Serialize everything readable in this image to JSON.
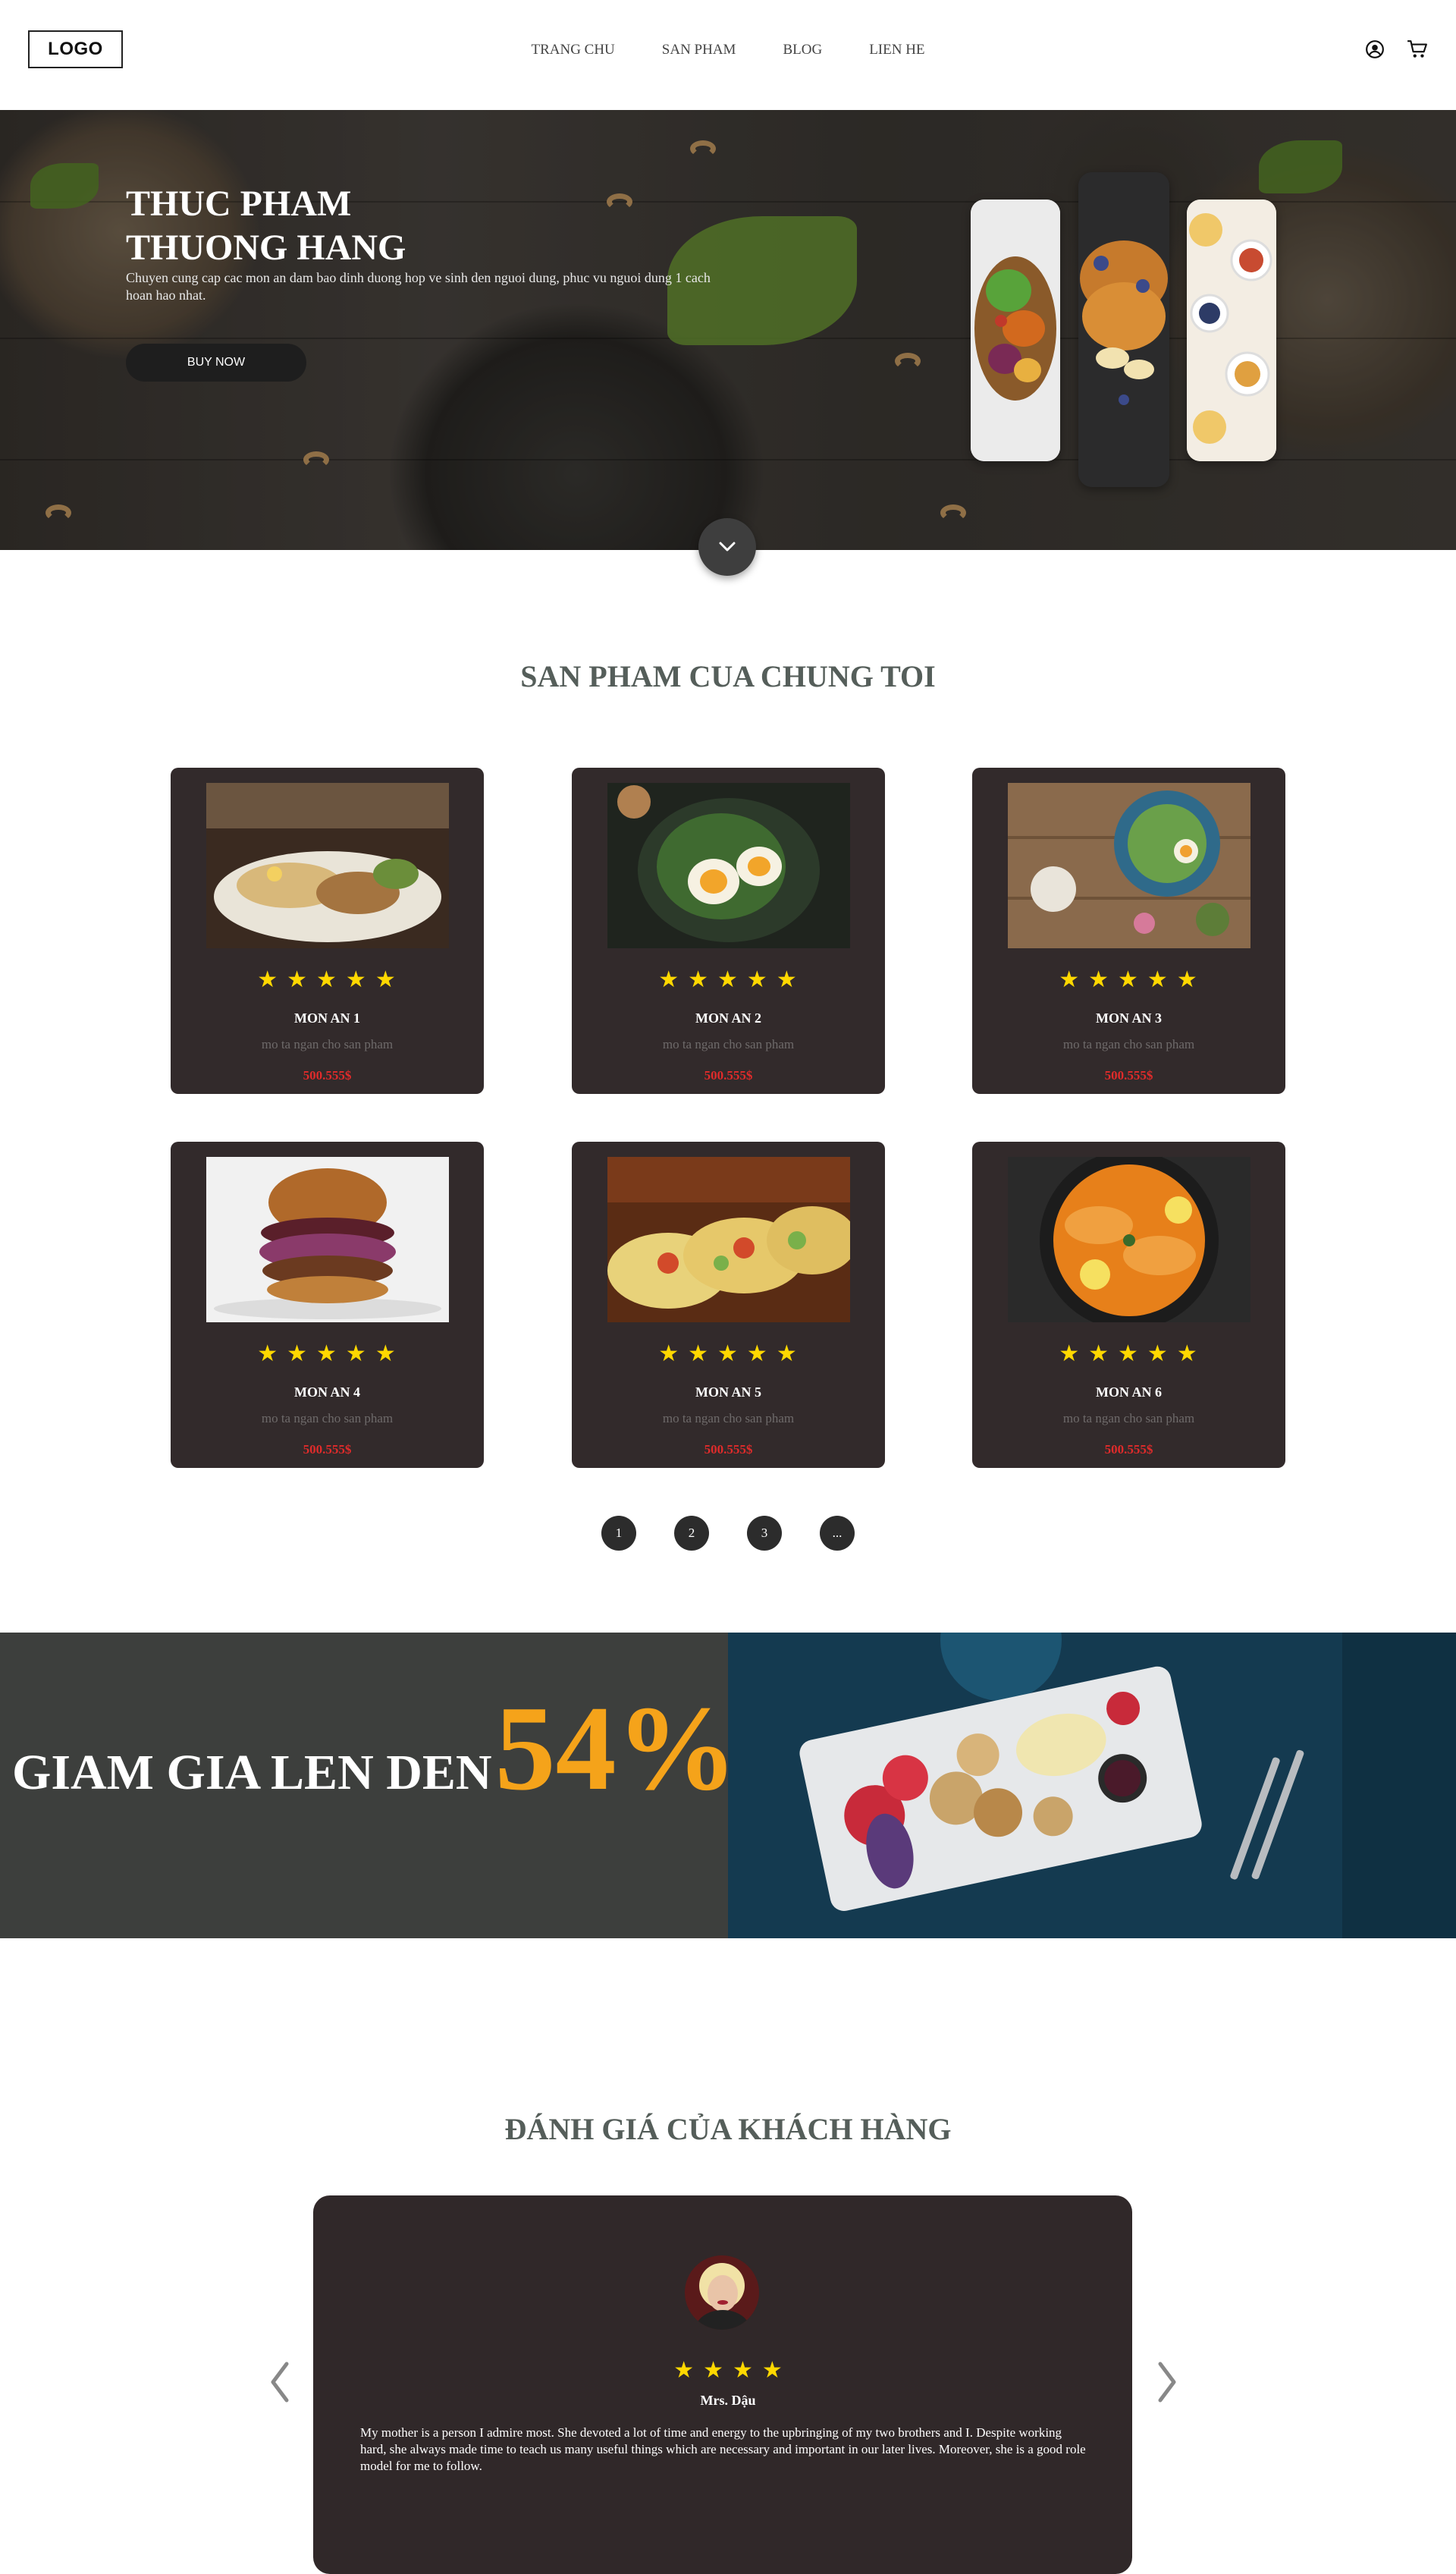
{
  "header": {
    "logo": "LOGO",
    "nav": [
      "TRANG CHU",
      "SAN PHAM",
      "BLOG",
      "LIEN HE"
    ],
    "icons": [
      "user-icon",
      "cart-icon"
    ]
  },
  "hero": {
    "title_line1": "THUC PHAM",
    "title_line2": "THUONG HANG",
    "subtitle": "Chuyen cung cap cac mon an dam bao dinh duong hop ve sinh den nguoi dung, phuc vu nguoi dung 1 cach hoan hao nhat.",
    "button": "BUY NOW",
    "scroll_icon": "chevron-down-icon"
  },
  "products": {
    "title": "SAN PHAM CUA CHUNG TOI",
    "rating_stars": "★★★★★",
    "items": [
      {
        "name": "MON AN 1",
        "desc": "mo ta ngan cho san pham",
        "price": "500.555$"
      },
      {
        "name": "MON AN 2",
        "desc": "mo ta ngan cho san pham",
        "price": "500.555$"
      },
      {
        "name": "MON AN 3",
        "desc": "mo ta ngan cho san pham",
        "price": "500.555$"
      },
      {
        "name": "MON AN 4",
        "desc": "mo ta ngan cho san pham",
        "price": "500.555$"
      },
      {
        "name": "MON AN 5",
        "desc": "mo ta ngan cho san pham",
        "price": "500.555$"
      },
      {
        "name": "MON AN 6",
        "desc": "mo ta ngan cho san pham",
        "price": "500.555$"
      }
    ],
    "pages": [
      "1",
      "2",
      "3",
      "..."
    ]
  },
  "promo": {
    "text": "GIAM GIA LEN DEN",
    "percent": "54%"
  },
  "reviews": {
    "title": "ĐÁNH GIÁ CỦA KHÁCH HÀNG",
    "stars": "★★★★",
    "name": "Mrs. Dậu",
    "text": "My mother is a person I admire most. She devoted a lot of time and energy to the upbringing of my two brothers and I. Despite working hard, she always made time to teach us many useful things which are necessary and important in our later lives. Moreover, she is a good role model for me to follow."
  },
  "colors": {
    "card_bg": "#322a2b",
    "star": "#ffd800",
    "price": "#e02b2b",
    "promo_accent": "#f5a31a",
    "title": "#555e5a"
  }
}
